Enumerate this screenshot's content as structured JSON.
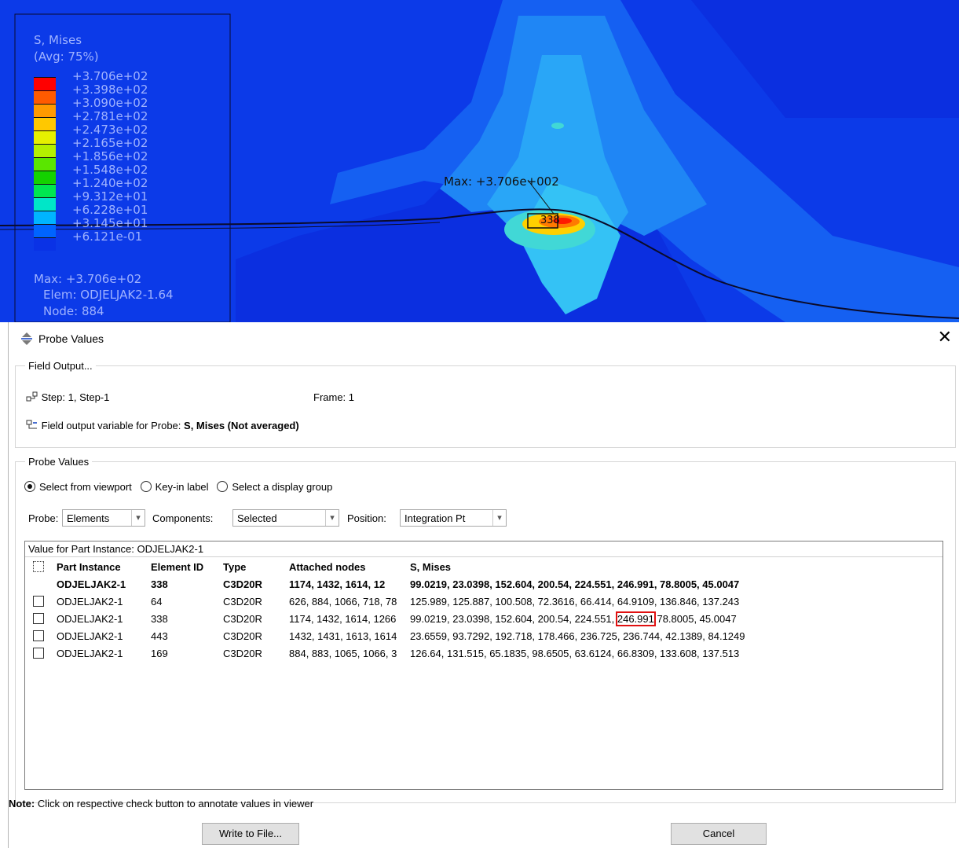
{
  "viewport": {
    "legend": {
      "title": "S, Mises",
      "subtitle": "(Avg: 75%)",
      "ticks": [
        "+3.706e+02",
        "+3.398e+02",
        "+3.090e+02",
        "+2.781e+02",
        "+2.473e+02",
        "+2.165e+02",
        "+1.856e+02",
        "+1.548e+02",
        "+1.240e+02",
        "+9.312e+01",
        "+6.228e+01",
        "+3.145e+01",
        "+6.121e-01"
      ],
      "colors": [
        "#ff0000",
        "#ff5a00",
        "#ff9a00",
        "#ffc800",
        "#e6f000",
        "#b4f000",
        "#5ae600",
        "#14d200",
        "#00e650",
        "#00e6c8",
        "#00b4ff",
        "#0064ff",
        "#0a32e6"
      ],
      "max_line": "Max: +3.706e+02",
      "elem_line": "Elem: ODJELJAK2-1.64",
      "node_line": "Node: 884"
    },
    "max_annotation": "Max: +3.706e+002",
    "element_tag": "338"
  },
  "dialog": {
    "title": "Probe Values",
    "field_output": {
      "legend": "Field Output...",
      "step_label": "Step:",
      "step_value": "1, Step-1",
      "frame_label": "Frame:",
      "frame_value": "1",
      "variable_label": "Field output variable for Probe:",
      "variable_value": "S, Mises (Not averaged)"
    },
    "probe_values": {
      "legend": "Probe Values",
      "radios": [
        "Select from viewport",
        "Key-in label",
        "Select a display group"
      ],
      "probe_label": "Probe:",
      "probe_value": "Elements",
      "components_label": "Components:",
      "components_value": "Selected",
      "position_label": "Position:",
      "position_value": "Integration Pt"
    },
    "table": {
      "instance_label": "Value for Part Instance:",
      "instance_value": "ODJELJAK2-1",
      "headers": [
        "Part Instance",
        "Element ID",
        "Type",
        "Attached nodes",
        "S, Mises"
      ],
      "current": [
        "ODJELJAK2-1",
        "338",
        "C3D20R",
        "1174, 1432, 1614, 12",
        "99.0219, 23.0398, 152.604, 200.54, 224.551, 246.991, 78.8005, 45.0047"
      ],
      "rows": [
        {
          "part": "ODJELJAK2-1",
          "id": "64",
          "type": "C3D20R",
          "nodes": "626, 884, 1066, 718, 78",
          "mises_pre": "125.989, 125.887, 100.508, 72.3616, 66.414, 64.9109, 136.846, 137.243",
          "mises_hl": "",
          "mises_post": ""
        },
        {
          "part": "ODJELJAK2-1",
          "id": "338",
          "type": "C3D20R",
          "nodes": "1174, 1432, 1614, 1266",
          "mises_pre": "99.0219, 23.0398, 152.604, 200.54, 224.551, ",
          "mises_hl": "246.991",
          "mises_post": " 78.8005, 45.0047"
        },
        {
          "part": "ODJELJAK2-1",
          "id": "443",
          "type": "C3D20R",
          "nodes": "1432, 1431, 1613, 1614",
          "mises_pre": "23.6559, 93.7292, 192.718, 178.466, 236.725, 236.744, 42.1389, 84.1249",
          "mises_hl": "",
          "mises_post": ""
        },
        {
          "part": "ODJELJAK2-1",
          "id": "169",
          "type": "C3D20R",
          "nodes": "884, 883, 1065, 1066, 3",
          "mises_pre": "126.64, 131.515, 65.1835, 98.6505, 63.6124, 66.8309, 133.608, 137.513",
          "mises_hl": "",
          "mises_post": ""
        }
      ]
    },
    "note_label": "Note:",
    "note_text": "Click on respective check button to annotate values in viewer",
    "write_button": "Write to File...",
    "cancel_button": "Cancel"
  }
}
